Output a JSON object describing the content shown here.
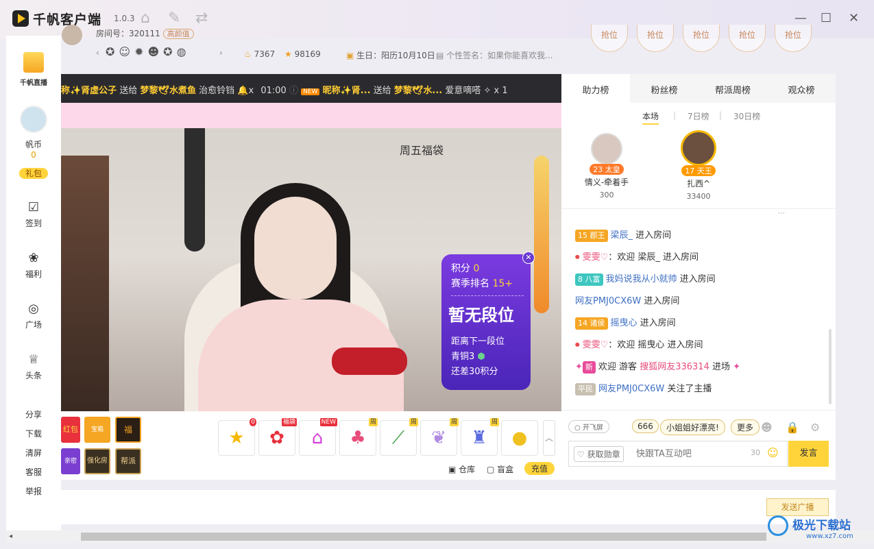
{
  "app": {
    "name": "千帆客户端",
    "version": "1.0.3"
  },
  "window_controls": {
    "minimize": "—",
    "maximize": "☐",
    "close": "✕"
  },
  "room": {
    "id_label": "房间号：320111",
    "tag": "高颜值",
    "fans": "7367",
    "stars": "98169",
    "birthday": "生日：阳历10月10日",
    "signature": "个性签名：如果你能喜欢我..."
  },
  "seats": [
    "抢位",
    "抢位",
    "抢位",
    "抢位",
    "抢位"
  ],
  "sidebar": {
    "brand": "千帆直播",
    "coin_label": "帆币",
    "coin_value": "0",
    "gift_pack": "礼包",
    "items": [
      {
        "label": "签到",
        "icon": "calendar-check-icon"
      },
      {
        "label": "福利",
        "icon": "welfare-icon"
      },
      {
        "label": "广场",
        "icon": "plaza-icon"
      },
      {
        "label": "头条",
        "icon": "headline-icon"
      }
    ],
    "links": [
      "分享",
      "下载",
      "清屏",
      "客服",
      "举报"
    ]
  },
  "ticker": {
    "a_name": "称✨肾虚公子",
    "a_action": "送给",
    "a_target": "梦黎🕊水煮鱼",
    "a_gift": "治愈铃铛",
    "a_count": "x",
    "time": "01:00",
    "new_tag": "NEW",
    "b_name": "昵称✨肾...",
    "b_action": "送给",
    "b_target": "梦黎🕊水...",
    "b_gift": "爱意嘀嗒",
    "b_count": "x 1"
  },
  "video": {
    "overlay_text": "周五福袋",
    "rank_card": {
      "score_label": "积分",
      "score_value": "0",
      "season_label": "赛季排名",
      "season_value": "15+",
      "title": "暂无段位",
      "next_label": "距离下一段位",
      "next_tier": "青铜3",
      "gap": "还差30积分"
    }
  },
  "gifts": {
    "left_items": [
      "红包",
      "宝箱",
      "福",
      "亲密",
      "强化房",
      "帮派"
    ],
    "items": [
      {
        "tag": "0",
        "icon": "star-face-icon"
      },
      {
        "tag": "福袋",
        "icon": "lucky-bag-icon"
      },
      {
        "tag": "NEW",
        "icon": "gift-shop-icon"
      },
      {
        "tag": "周",
        "icon": "lollipop-icon"
      },
      {
        "tag": "周",
        "icon": "cucumber-icon"
      },
      {
        "tag": "周",
        "icon": "wings-icon"
      },
      {
        "tag": "周",
        "icon": "castle-icon"
      },
      {
        "tag": "",
        "icon": "lemon-icon"
      }
    ],
    "warehouse": "仓库",
    "blindbox": "盲盒",
    "recharge": "充值"
  },
  "rank_tabs": [
    "助力榜",
    "粉丝榜",
    "帮派周榜",
    "观众榜"
  ],
  "rank_subtabs": [
    "本场",
    "7日榜",
    "30日榜"
  ],
  "top_users": [
    {
      "level": "23",
      "title": "太皇",
      "name": "情义-牵着手",
      "score": "300"
    },
    {
      "level": "17",
      "title": "天王",
      "name": "扎西^",
      "score": "33400"
    }
  ],
  "chat": [
    {
      "level": "15",
      "title": "郡王",
      "name": "梁辰_",
      "text": "进入房间"
    },
    {
      "badge": "mic",
      "name": "雯雯♡",
      "text": "：欢迎 梁辰_ 进入房间"
    },
    {
      "level": "8",
      "title": "八富",
      "name": "我妈说我从小就帅",
      "text": "进入房间"
    },
    {
      "name": "网友PMJ0CX6W",
      "text": "进入房间"
    },
    {
      "level": "14",
      "title": "诸侯",
      "name": "摇曳心",
      "text": "进入房间"
    },
    {
      "badge": "mic",
      "name": "雯雯♡",
      "text": "：欢迎 摇曳心 进入房间"
    },
    {
      "badge": "新",
      "prefix": "欢迎 游客",
      "name": "搜狐网友336314",
      "text": "进场"
    },
    {
      "title": "平民",
      "name": "网友PMJ0CX6W",
      "text": "关注了主播"
    }
  ],
  "chat_tools": {
    "flyscreen": "开飞屏",
    "quick1": "666",
    "quick2": "小姐姐好漂亮!",
    "more": "更多",
    "medal": "获取勋章",
    "placeholder": "快跟TA互动吧",
    "counter": "30",
    "send": "发言"
  },
  "broadcast": {
    "button": "发送广播"
  },
  "watermark": {
    "name": "极光下载站",
    "url": "www.xz7.com"
  }
}
